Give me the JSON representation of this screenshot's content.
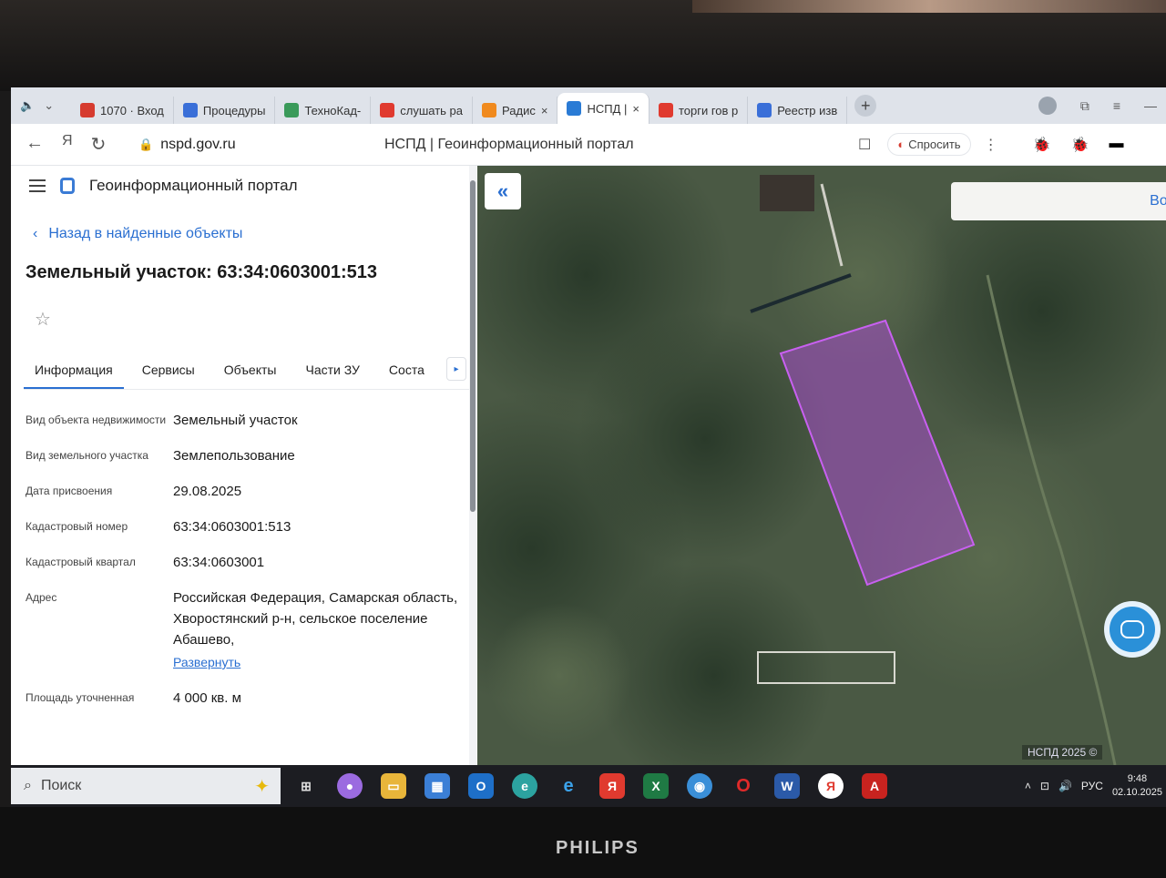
{
  "browser": {
    "tabs": [
      {
        "label": "1070 · Вход",
        "icon": "mail-icon",
        "color": "#d63b2f"
      },
      {
        "label": "Процедуры",
        "icon": "globe-icon",
        "color": "#3a6fd8"
      },
      {
        "label": "ТехноКад-",
        "icon": "gmail-icon",
        "color": "#3a9a5a"
      },
      {
        "label": "слушать ра",
        "icon": "yandex-icon",
        "color": "#e03a2f"
      },
      {
        "label": "Радис",
        "icon": "play-icon",
        "color": "#f08a1e"
      },
      {
        "label": "НСПД |",
        "icon": "nspd-icon",
        "color": "#2a7bd5",
        "active": true
      },
      {
        "label": "торги гов р",
        "icon": "yandex-icon",
        "color": "#e03a2f"
      },
      {
        "label": "Реестр изв",
        "icon": "shield-icon",
        "color": "#3a6fd8"
      }
    ],
    "url": "nspd.gov.ru",
    "page_title": "НСПД | Геоинформационный портал",
    "ask_label": "Спросить"
  },
  "panel": {
    "brand": "Геоинформационный портал",
    "back_link": "Назад в найденные объекты",
    "heading": "Земельный участок: 63:34:0603001:513",
    "tabs": [
      "Информация",
      "Сервисы",
      "Объекты",
      "Части ЗУ",
      "Соста"
    ],
    "rows": [
      {
        "label": "Вид объекта недвижимости",
        "value": "Земельный участок"
      },
      {
        "label": "Вид земельного участка",
        "value": "Землепользование"
      },
      {
        "label": "Дата присвоения",
        "value": "29.08.2025"
      },
      {
        "label": "Кадастровый номер",
        "value": "63:34:0603001:513"
      },
      {
        "label": "Кадастровый квартал",
        "value": "63:34:0603001"
      },
      {
        "label": "Адрес",
        "value": "Российская Федерация, Самарская область, Хворостянский р-н, сельское поселение Абашево,",
        "link": "Развернуть"
      },
      {
        "label": "Площадь уточненная",
        "value": "4 000 кв. м"
      }
    ]
  },
  "map": {
    "login_label": "Войт",
    "copyright": "НСПД 2025 ©",
    "parcel_color": "#b04cd8"
  },
  "taskbar": {
    "search_placeholder": "Поиск",
    "lang": "РУС",
    "time": "9:48",
    "date": "02.10.2025"
  },
  "monitor": {
    "brand": "PHILIPS"
  }
}
